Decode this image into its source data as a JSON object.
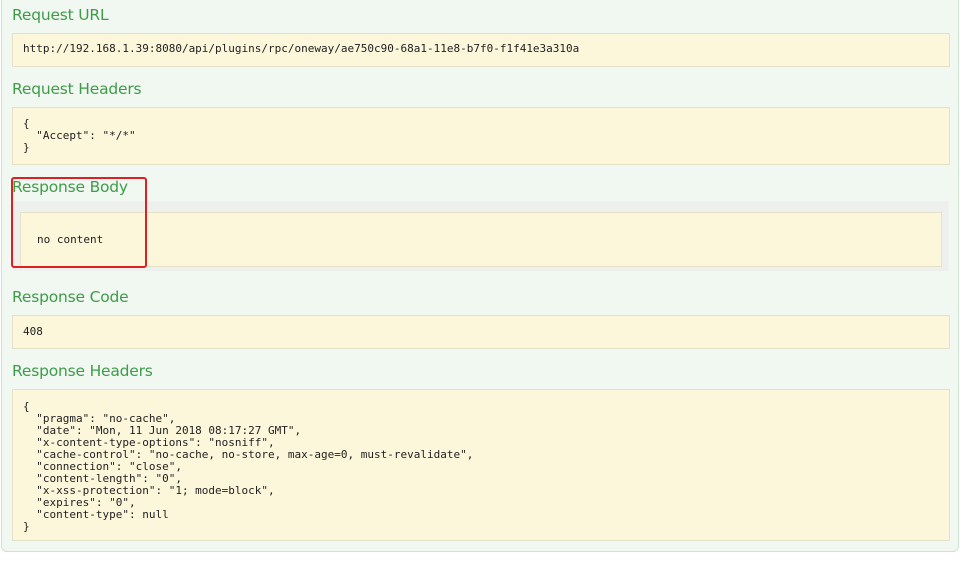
{
  "request_url": {
    "heading": "Request URL",
    "value": "http://192.168.1.39:8080/api/plugins/rpc/oneway/ae750c90-68a1-11e8-b7f0-f1f41e3a310a"
  },
  "request_headers": {
    "heading": "Request Headers",
    "value": "{\n  \"Accept\": \"*/*\"\n}"
  },
  "response_body": {
    "heading": "Response Body",
    "value": "no content"
  },
  "response_code": {
    "heading": "Response Code",
    "value": "408"
  },
  "response_headers": {
    "heading": "Response Headers",
    "value": "{\n  \"pragma\": \"no-cache\",\n  \"date\": \"Mon, 11 Jun 2018 08:17:27 GMT\",\n  \"x-content-type-options\": \"nosniff\",\n  \"cache-control\": \"no-cache, no-store, max-age=0, must-revalidate\",\n  \"connection\": \"close\",\n  \"content-length\": \"0\",\n  \"x-xss-protection\": \"1; mode=block\",\n  \"expires\": \"0\",\n  \"content-type\": null\n}"
  },
  "colors": {
    "heading": "#3f9b4a",
    "code_background": "#fcf6db",
    "annotation_box": "#e02020"
  }
}
